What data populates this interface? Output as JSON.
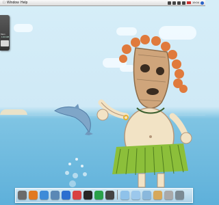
{
  "menubar": {
    "apple_icon": "apple-icon",
    "menus": [
      "Window",
      "Help"
    ],
    "clock": "19:04"
  },
  "widget": {
    "label": "Mem",
    "value": "1.04 GB"
  },
  "dock": {
    "apps": [
      {
        "name": "finder-icon",
        "color": "#6b6b6b"
      },
      {
        "name": "firefox-icon",
        "color": "#e1791f"
      },
      {
        "name": "itunes-icon",
        "color": "#3d8bd8"
      },
      {
        "name": "iphoto-icon",
        "color": "#5b88b5"
      },
      {
        "name": "safari-icon",
        "color": "#2c6fd0"
      },
      {
        "name": "calendar-icon",
        "color": "#d94141"
      },
      {
        "name": "terminal-icon",
        "color": "#262626"
      },
      {
        "name": "utorrent-icon",
        "color": "#29a04a"
      },
      {
        "name": "dashboard-icon",
        "color": "#444444"
      },
      {
        "name": "applications-folder-icon",
        "color": "#8fc2ea"
      },
      {
        "name": "documents-folder-icon",
        "color": "#9cc8ec"
      },
      {
        "name": "downloads-folder-icon",
        "color": "#8ab8dc"
      },
      {
        "name": "preview-icon",
        "color": "#d6a85a"
      },
      {
        "name": "system-preferences-icon",
        "color": "#a9a9a9"
      },
      {
        "name": "trash-icon",
        "color": "#7b8a93"
      }
    ]
  }
}
